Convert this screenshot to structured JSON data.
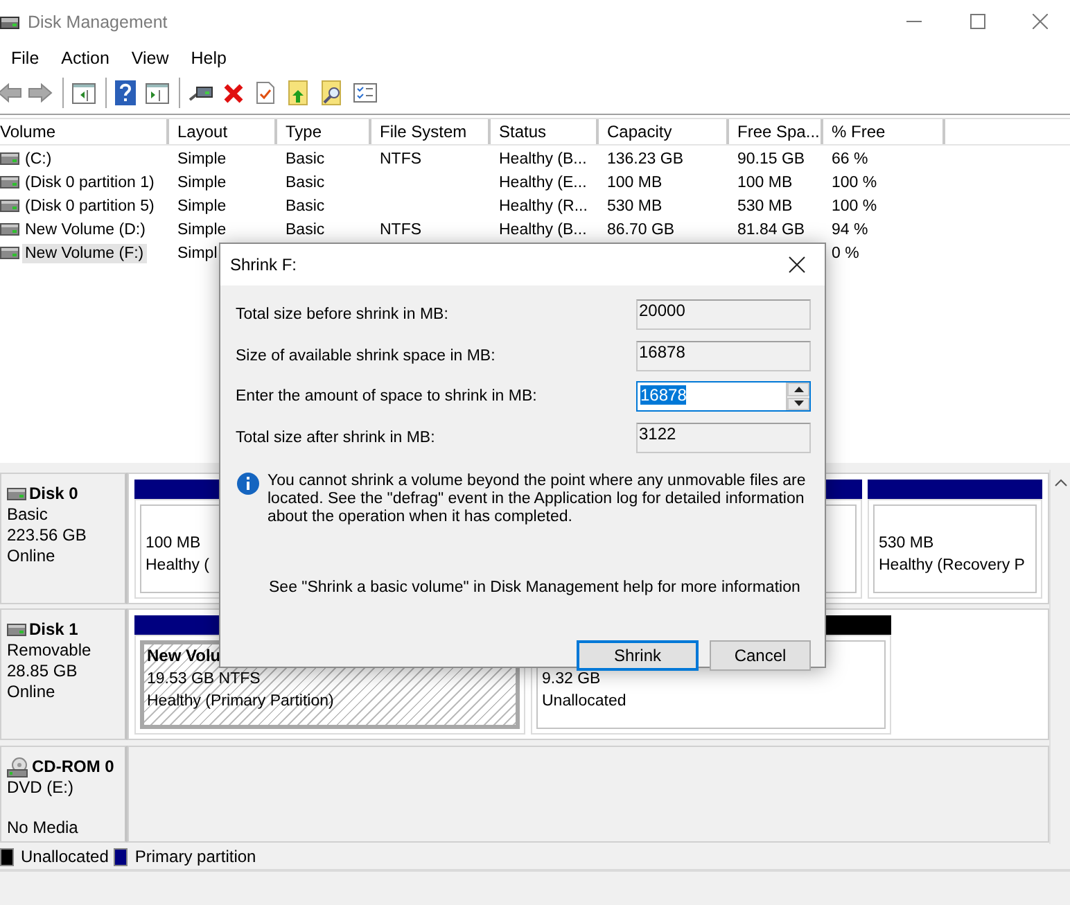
{
  "window": {
    "title": "Disk Management"
  },
  "menu": [
    "File",
    "Action",
    "View",
    "Help"
  ],
  "volume_list": {
    "columns": [
      "Volume",
      "Layout",
      "Type",
      "File System",
      "Status",
      "Capacity",
      "Free Spa...",
      "% Free"
    ],
    "rows": [
      {
        "selected": false,
        "cells": [
          "(C:)",
          "Simple",
          "Basic",
          "NTFS",
          "Healthy (B...",
          "136.23 GB",
          "90.15 GB",
          "66 %"
        ]
      },
      {
        "selected": false,
        "cells": [
          "(Disk 0 partition 1)",
          "Simple",
          "Basic",
          null,
          "Healthy (E...",
          "100 MB",
          "100 MB",
          "100 %"
        ]
      },
      {
        "selected": false,
        "cells": [
          "(Disk 0 partition 5)",
          "Simple",
          "Basic",
          null,
          "Healthy (R...",
          "530 MB",
          "530 MB",
          "100 %"
        ]
      },
      {
        "selected": false,
        "cells": [
          "New Volume (D:)",
          "Simple",
          "Basic",
          "NTFS",
          "Healthy (B...",
          "86.70 GB",
          "81.84 GB",
          "94 %"
        ]
      },
      {
        "selected": true,
        "cells": [
          "New Volume (F:)",
          "Simpl",
          null,
          null,
          null,
          null,
          null,
          "0 %"
        ]
      }
    ]
  },
  "disks": [
    {
      "kind": "disk",
      "name": "Disk 0",
      "lines": [
        "Basic",
        "223.56 GB",
        "Online"
      ],
      "partitions": [
        {
          "kind": "primary",
          "selected": false,
          "lines": [
            "100 MB",
            "Healthy ("
          ]
        },
        {
          "kind": "primary",
          "selected": false,
          "lines": [
            "530 MB",
            "Healthy (Recovery P"
          ]
        }
      ]
    },
    {
      "kind": "disk",
      "name": "Disk 1",
      "lines": [
        "Removable",
        "28.85 GB",
        "Online"
      ],
      "partitions": [
        {
          "kind": "primary",
          "selected": true,
          "title": "New Volu",
          "lines": [
            "19.53 GB NTFS",
            "Healthy (Primary Partition)"
          ]
        },
        {
          "kind": "unallocated",
          "selected": false,
          "lines": [
            "9.32 GB",
            "Unallocated"
          ]
        }
      ]
    },
    {
      "kind": "cdrom",
      "name": "CD-ROM 0",
      "lines": [
        "DVD (E:)",
        "No Media"
      ]
    }
  ],
  "legend": [
    {
      "label": "Unallocated",
      "color": "#000000"
    },
    {
      "label": "Primary partition",
      "color": "#000080"
    }
  ],
  "dialog": {
    "title": "Shrink F:",
    "fields": [
      {
        "kind": "readonly",
        "label": "Total size before shrink in MB:",
        "value": "20000"
      },
      {
        "kind": "readonly",
        "label": "Size of available shrink space in MB:",
        "value": "16878"
      },
      {
        "kind": "spin",
        "label": "Enter the amount of space to shrink in MB:",
        "value": "16878",
        "focused": true
      },
      {
        "kind": "readonly",
        "label": "Total size after shrink in MB:",
        "value": "3122"
      }
    ],
    "message": "You cannot shrink a volume beyond the point where any unmovable files are located. See the \"defrag\" event in the Application log for detailed information about the operation when it has completed.",
    "help_note": "See \"Shrink a basic volume\" in Disk Management help for more information",
    "buttons": [
      {
        "label": "Shrink",
        "default": true
      },
      {
        "label": "Cancel",
        "default": false
      }
    ]
  }
}
